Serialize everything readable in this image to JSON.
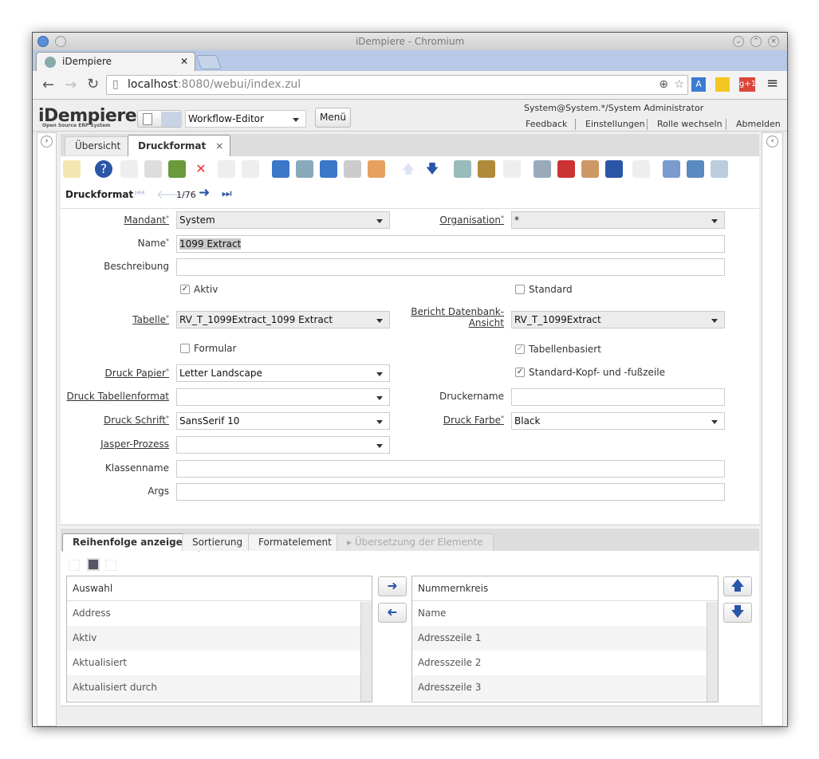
{
  "browser": {
    "window_title": "iDempiere - Chromium",
    "tab_title": "iDempiere",
    "url_host": "localhost",
    "url_rest": ":8080/webui/index.zul"
  },
  "header": {
    "logo": "iDempiere",
    "logo_sub": "Open Source ERP System",
    "menu_select": "Workflow-Editor",
    "menu_button": "Menü",
    "user": "System@System.*/System Administrator",
    "links": [
      "Feedback",
      "Einstellungen",
      "Rolle wechseln",
      "Abmelden"
    ]
  },
  "tabs": [
    {
      "label": "Übersicht"
    },
    {
      "label": "Druckformat",
      "active": true
    }
  ],
  "toolbar": {
    "icons": [
      "undo-icon",
      "help-icon",
      "new-record-icon",
      "copy-record-icon",
      "delete-icon",
      "delete-selection-icon",
      "save-icon",
      "save-create-icon",
      "refresh-icon",
      "find-icon",
      "attachment-icon",
      "chat-icon",
      "grid-toggle-icon",
      "previous-record-icon",
      "next-record-icon",
      "report-icon",
      "archive-icon",
      "print-icon",
      "zoom-across-icon",
      "parent-record-icon",
      "request-icon",
      "product-info-icon",
      "post-icon",
      "process-icon",
      "export-icon",
      "import-icon"
    ]
  },
  "nav": {
    "title": "Druckformat",
    "record": "1/76"
  },
  "form": {
    "mandant_label": "Mandant",
    "mandant": "System",
    "organisation_label": "Organisation",
    "organisation": "*",
    "name_label": "Name",
    "name": "1099 Extract",
    "beschreibung_label": "Beschreibung",
    "beschreibung": "",
    "aktiv_label": "Aktiv",
    "aktiv": true,
    "standard_label": "Standard",
    "standard": false,
    "tabelle_label": "Tabelle",
    "tabelle": "RV_T_1099Extract_1099 Extract",
    "bericht_label": "Bericht Datenbank-Ansicht",
    "bericht": "RV_T_1099Extract",
    "formular_label": "Formular",
    "formular": false,
    "tabellenbasiert_label": "Tabellenbasiert",
    "tabellenbasiert": true,
    "papier_label": "Druck Papier",
    "papier": "Letter Landscape",
    "kopf_label": "Standard-Kopf- und -fußzeile",
    "kopf": true,
    "tabformat_label": "Druck Tabellenformat",
    "tabformat": "",
    "druckername_label": "Druckername",
    "druckername": "",
    "schrift_label": "Druck Schrift",
    "schrift": "SansSerif 10",
    "farbe_label": "Druck Farbe",
    "farbe": "Black",
    "jasper_label": "Jasper-Prozess",
    "jasper": "",
    "klassenname_label": "Klassenname",
    "klassenname": "",
    "args_label": "Args",
    "args": ""
  },
  "detail": {
    "tabs": [
      "Reihenfolge anzeigen",
      "Sortierung",
      "Formatelement",
      "Übersetzung der Elemente"
    ],
    "left": {
      "header": "Auswahl",
      "items": [
        "Address",
        "Aktiv",
        "Aktualisiert",
        "Aktualisiert durch"
      ]
    },
    "right": {
      "header": "Nummernkreis",
      "items": [
        "Name",
        "Adresszeile 1",
        "Adresszeile 2",
        "Adresszeile 3"
      ]
    }
  },
  "colors": {
    "accent": "#2b56a8",
    "tabstrip": "#b7c9e6"
  }
}
